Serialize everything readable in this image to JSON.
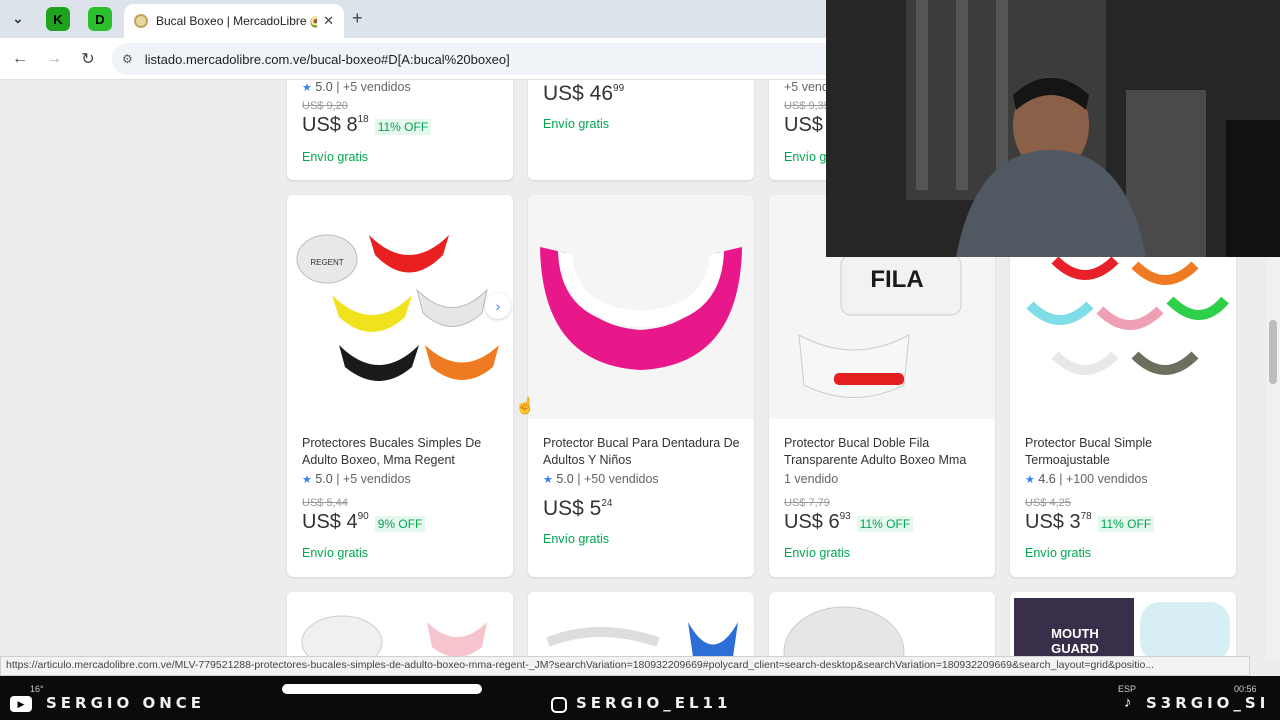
{
  "browser": {
    "tab_title": "Bucal Boxeo | MercadoLibre 🥑",
    "url": "listado.mercadolibre.com.ve/bucal-boxeo#D[A:bucal%20boxeo]",
    "new_tab": "+",
    "tab_close": "✕",
    "ext1": "K",
    "ext2": "D"
  },
  "top_row": [
    {
      "rating": "5.0",
      "sold": "| +5 vendidos",
      "old_price": "US$ 9,20",
      "price": "US$ 8",
      "cents": "18",
      "off": "11% OFF",
      "shipping": "Envío gratis"
    },
    {
      "price": "US$ 46",
      "cents": "99",
      "shipping": "Envío gratis"
    },
    {
      "sold": "+5 vendi",
      "old_price": "US$ 9,35",
      "price": "US$",
      "shipping": "Envío g"
    }
  ],
  "products": [
    {
      "title": "Protectores Bucales Simples De Adulto Boxeo, Mma Regent",
      "rating": "5.0",
      "sold": "| +5 vendidos",
      "old_price": "US$ 5,44",
      "price": "US$ 4",
      "cents": "90",
      "off": "9% OFF",
      "shipping": "Envío gratis"
    },
    {
      "title": "Protector Bucal Para Dentadura De Adultos Y Niños",
      "rating": "5.0",
      "sold": "| +50 vendidos",
      "price": "US$ 5",
      "cents": "24",
      "shipping": "Envío gratis"
    },
    {
      "title": "Protector Bucal Doble Fila Transparente Adulto Boxeo Mma",
      "sold": "1 vendido",
      "old_price": "US$ 7,79",
      "price": "US$ 6",
      "cents": "93",
      "off": "11% OFF",
      "shipping": "Envío gratis",
      "brand": "FILA"
    },
    {
      "title": "Protector Bucal Simple Termoajustable",
      "rating": "4.6",
      "sold": "| +100 vendidos",
      "old_price": "US$ 4,25",
      "price": "US$ 3",
      "cents": "78",
      "off": "11% OFF",
      "shipping": "Envío gratis"
    }
  ],
  "bottom_row": {
    "mouth_guard_label": "MOUTH GUARD"
  },
  "status_url": "https://articulo.mercadolibre.com.ve/MLV-779521288-protectores-bucales-simples-de-adulto-boxeo-mma-regent-_JM?searchVariation=180932209669#polycard_client=search-desktop&searchVariation=180932209669&search_layout=grid&positio...",
  "overlay": {
    "youtube": "SERGIO ONCE",
    "instagram": "SERGIO_EL11",
    "tiktok": "S3RGIO_SI"
  },
  "taskbar": {
    "temp": "16°",
    "lang": "ESP",
    "time": "00:56"
  },
  "colors": {
    "green": "#00a650",
    "blue_star": "#3483fa",
    "pink": "#e8178a"
  }
}
